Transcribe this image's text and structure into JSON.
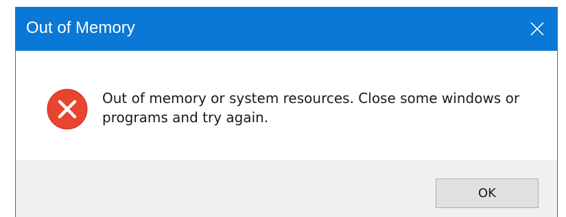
{
  "dialog": {
    "title": "Out of Memory",
    "message": "Out of memory or system resources. Close some windows or programs and try again.",
    "icon": "error-icon",
    "ok_label": "OK"
  },
  "colors": {
    "titlebar": "#0a78d6",
    "error_icon": "#e8442e",
    "footer": "#f0f0f0"
  }
}
